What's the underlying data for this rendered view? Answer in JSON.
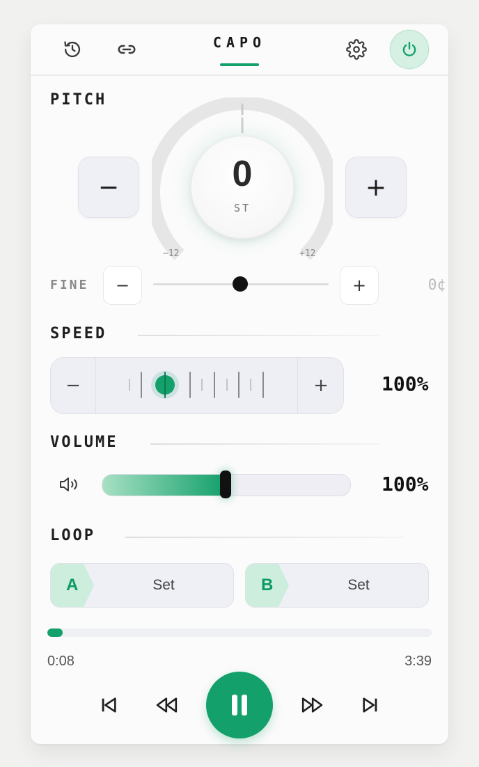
{
  "app": {
    "title": "CAPO"
  },
  "header": {
    "icons": [
      "history-icon",
      "link-icon",
      "gear-icon",
      "power-icon"
    ]
  },
  "pitch": {
    "label": "PITCH",
    "value": "0",
    "unit": "ST",
    "min_label": "−12",
    "max_label": "+12",
    "minus": "−",
    "plus": "+",
    "semitones": 0
  },
  "fine": {
    "label": "FINE",
    "minus": "−",
    "plus": "+",
    "value": "0¢",
    "position": 0.5
  },
  "speed": {
    "label": "SPEED",
    "minus": "−",
    "plus": "+",
    "value": "100%"
  },
  "volume": {
    "label": "VOLUME",
    "value": "100%",
    "level": 0.5
  },
  "loop": {
    "label": "LOOP",
    "a": {
      "tag": "A",
      "label": "Set"
    },
    "b": {
      "tag": "B",
      "label": "Set"
    }
  },
  "transport": {
    "elapsed": "0:08",
    "duration": "3:39",
    "progress": 0.04
  },
  "colors": {
    "accent": "#13a06b",
    "accent_soft": "#cdeedd",
    "background": "#f1f1f0",
    "card": "#fbfbfb"
  }
}
